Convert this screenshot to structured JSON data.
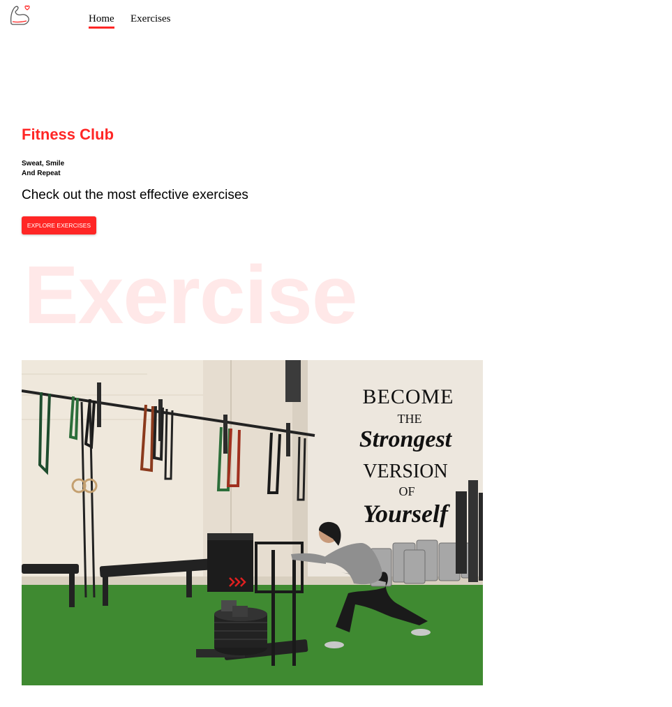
{
  "nav": {
    "logo_icon": "flexed-arm-heart-icon",
    "links": [
      {
        "label": "Home",
        "active": true
      },
      {
        "label": "Exercises",
        "active": false
      }
    ]
  },
  "hero": {
    "title": "Fitness Club",
    "subtitle_line1": "Sweat, Smile",
    "subtitle_line2": "And Repeat",
    "description": "Check out the most effective exercises",
    "button_label": "EXPLORE EXERCISES",
    "watermark": "Exercise"
  },
  "banner": {
    "wall_text": [
      "BECOME",
      "THE",
      "Strongest",
      "VERSION",
      "OF",
      "Yourself"
    ]
  },
  "colors": {
    "accent": "#ff2625",
    "watermark": "#ffe3e3",
    "turf": "#3d8a2f",
    "wall": "#e8dfd0"
  }
}
